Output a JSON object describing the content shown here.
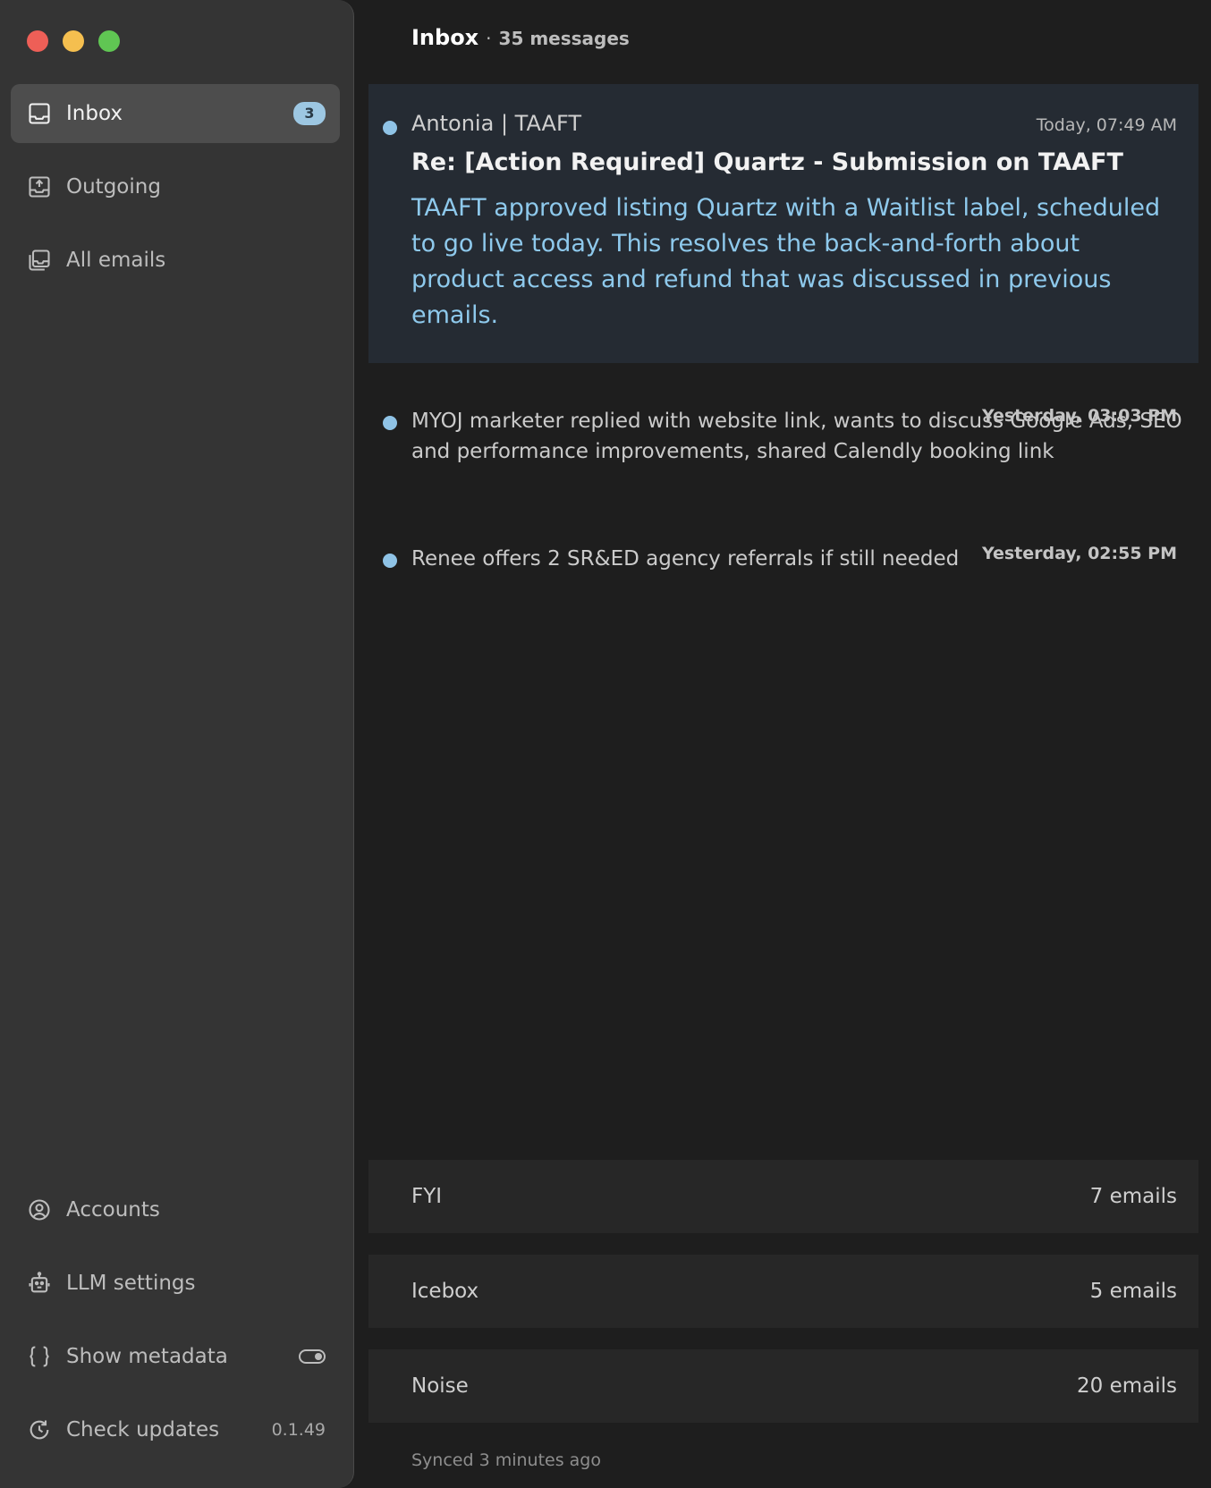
{
  "sidebar": {
    "nav": [
      {
        "label": "Inbox",
        "badge": "3",
        "icon": "inbox-icon"
      },
      {
        "label": "Outgoing",
        "icon": "outbox-icon"
      },
      {
        "label": "All emails",
        "icon": "stack-icon"
      }
    ],
    "bottom": [
      {
        "label": "Accounts",
        "icon": "user-circle-icon"
      },
      {
        "label": "LLM settings",
        "icon": "robot-icon"
      },
      {
        "label": "Show metadata",
        "icon": "braces-icon"
      },
      {
        "label": "Check updates",
        "icon": "refresh-icon",
        "version": "0.1.49"
      }
    ]
  },
  "header": {
    "title": "Inbox",
    "separator": "·",
    "count": "35 messages"
  },
  "emails": {
    "selected": {
      "sender": "Antonia | TAAFT",
      "time": "Today, 07:49 AM",
      "subject": "Re: [Action Required] Quartz - Submission on TAAFT",
      "summary": "TAAFT approved listing Quartz with a Waitlist label, scheduled to go live today. This resolves the back-and-forth about product access and refund that was discussed in previous emails."
    },
    "list": [
      {
        "text": "MYOJ marketer replied with website link, wants to discuss Google Ads, SEO and performance improvements, shared Calendly booking link",
        "time": "Yesterday, 03:03 PM"
      },
      {
        "text": "Renee offers 2 SR&ED agency referrals if still needed",
        "time": "Yesterday, 02:55 PM"
      }
    ]
  },
  "groups": [
    {
      "name": "FYI",
      "count": "7 emails"
    },
    {
      "name": "Icebox",
      "count": "5 emails"
    },
    {
      "name": "Noise",
      "count": "20 emails"
    }
  ],
  "status": {
    "synced": "Synced 3 minutes ago"
  },
  "colors": {
    "accent": "#8ec9ec",
    "unread_dot": "#8fc3e6",
    "sidebar_bg": "#343434",
    "main_bg": "#1e1e1e"
  }
}
